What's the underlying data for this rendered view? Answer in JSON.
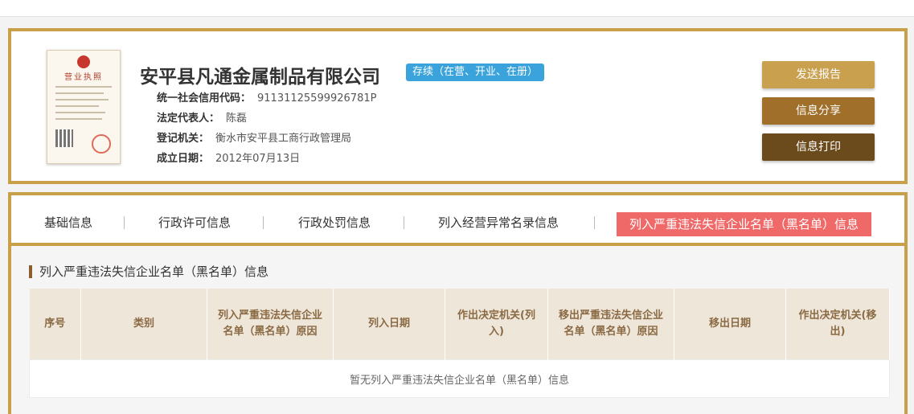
{
  "company": {
    "name": "安平县凡通金属制品有限公司",
    "status": "存续（在营、开业、在册）",
    "license_title": "营业执照",
    "fields": [
      {
        "label": "统一社会信用代码：",
        "value": "91131125599926781P"
      },
      {
        "label": "法定代表人：",
        "value": "陈磊"
      },
      {
        "label": "登记机关：",
        "value": "衡水市安平县工商行政管理局"
      },
      {
        "label": "成立日期：",
        "value": "2012年07月13日"
      }
    ]
  },
  "actions": {
    "send_report": "发送报告",
    "share": "信息分享",
    "print": "信息打印",
    "colors": {
      "send_report": "#c9a04e",
      "share": "#a0702a",
      "print": "#6b4a1c"
    }
  },
  "tabs": [
    {
      "label": "基础信息"
    },
    {
      "label": "行政许可信息"
    },
    {
      "label": "行政处罚信息"
    },
    {
      "label": "列入经营异常名录信息"
    },
    {
      "label": "列入严重违法失信企业名单（黑名单）信息",
      "active": true
    }
  ],
  "section": {
    "title": "列入严重违法失信企业名单（黑名单）信息",
    "columns": [
      "序号",
      "类别",
      "列入严重违法失信企业名单（黑名单）原因",
      "列入日期",
      "作出决定机关(列入)",
      "移出严重违法失信企业名单（黑名单）原因",
      "移出日期",
      "作出决定机关(移出)"
    ],
    "empty_message": "暂无列入严重违法失信企业名单（黑名单）信息"
  },
  "theme": {
    "accent": "#c9a04a",
    "active_tab": "#f06969",
    "badge": "#3aa3dc"
  }
}
